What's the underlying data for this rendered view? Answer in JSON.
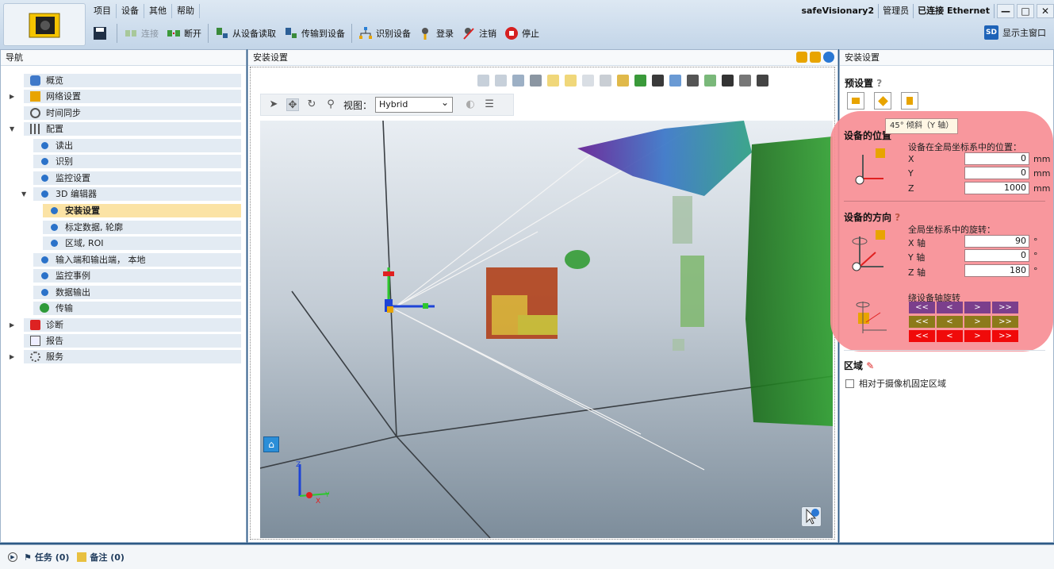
{
  "menu": {
    "items": [
      "项目",
      "设备",
      "其他",
      "帮助"
    ]
  },
  "toolbar": {
    "connect": "连接",
    "disconnect": "断开",
    "read_from_device": "从设备读取",
    "transfer_to_device": "传输到设备",
    "identify_device": "识别设备",
    "login": "登录",
    "logout": "注销",
    "stop": "停止",
    "show_main_window": "显示主窗口",
    "sd_badge": "SD"
  },
  "status": {
    "device": "safeVisionary2",
    "user": "管理员",
    "connection": "已连接 Ethernet"
  },
  "nav": {
    "title": "导航",
    "items": [
      "概览",
      "网络设置",
      "时间同步",
      "配置",
      "读出",
      "识别",
      "监控设置",
      "3D 编辑器",
      "安装设置",
      "标定数据, 轮廓",
      "区域, ROI",
      "输入端和输出端， 本地",
      "监控事例",
      "数据输出",
      "传输",
      "诊断",
      "报告",
      "服务"
    ]
  },
  "viewer": {
    "title": "安装设置",
    "view_label": "视图：",
    "view_value": "Hybrid",
    "axis_x": "X",
    "axis_y": "Y",
    "axis_z": "Z"
  },
  "setup": {
    "title": "安装设置",
    "presets_label": "预设置",
    "tooltip": "45° 倾斜（Y 轴）",
    "position_title": "设备的位置",
    "position_desc": "设备在全局坐标系中的位置：",
    "x_label": "X",
    "y_label": "Y",
    "z_label": "Z",
    "x_value": "0",
    "y_value": "0",
    "z_value": "1000",
    "unit_mm": "mm",
    "orientation_title": "设备的方向",
    "orientation_desc": "全局坐标系中的旋转：",
    "x_axis_label": "X 轴",
    "y_axis_label": "Y 轴",
    "z_axis_label": "Z 轴",
    "x_rot": "90",
    "y_rot": "0",
    "z_rot": "180",
    "unit_deg": "°",
    "rotate_about": "绕设备轴旋转",
    "rotate_buttons": [
      "<<",
      "<",
      ">",
      ">>"
    ],
    "area_title": "区域",
    "fixed_area_label": "相对于摄像机固定区域"
  },
  "bottom": {
    "tasks": "任务 (0)",
    "notes": "备注 (0)"
  }
}
